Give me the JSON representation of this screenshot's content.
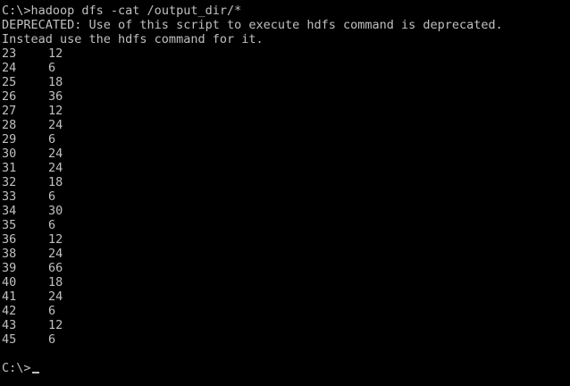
{
  "prompt": "C:\\>",
  "command": "hadoop dfs -cat /output_dir/*",
  "messages": [
    "DEPRECATED: Use of this script to execute hdfs command is deprecated.",
    "Instead use the hdfs command for it."
  ],
  "rows": [
    {
      "key": "23",
      "value": "12"
    },
    {
      "key": "24",
      "value": "6"
    },
    {
      "key": "25",
      "value": "18"
    },
    {
      "key": "26",
      "value": "36"
    },
    {
      "key": "27",
      "value": "12"
    },
    {
      "key": "28",
      "value": "24"
    },
    {
      "key": "29",
      "value": "6"
    },
    {
      "key": "30",
      "value": "24"
    },
    {
      "key": "31",
      "value": "24"
    },
    {
      "key": "32",
      "value": "18"
    },
    {
      "key": "33",
      "value": "6"
    },
    {
      "key": "34",
      "value": "30"
    },
    {
      "key": "35",
      "value": "6"
    },
    {
      "key": "36",
      "value": "12"
    },
    {
      "key": "38",
      "value": "24"
    },
    {
      "key": "39",
      "value": "66"
    },
    {
      "key": "40",
      "value": "18"
    },
    {
      "key": "41",
      "value": "24"
    },
    {
      "key": "42",
      "value": "6"
    },
    {
      "key": "43",
      "value": "12"
    },
    {
      "key": "45",
      "value": "6"
    }
  ],
  "final_prompt": "C:\\>",
  "colors": {
    "background": "#000000",
    "text": "#c0c0c0"
  }
}
